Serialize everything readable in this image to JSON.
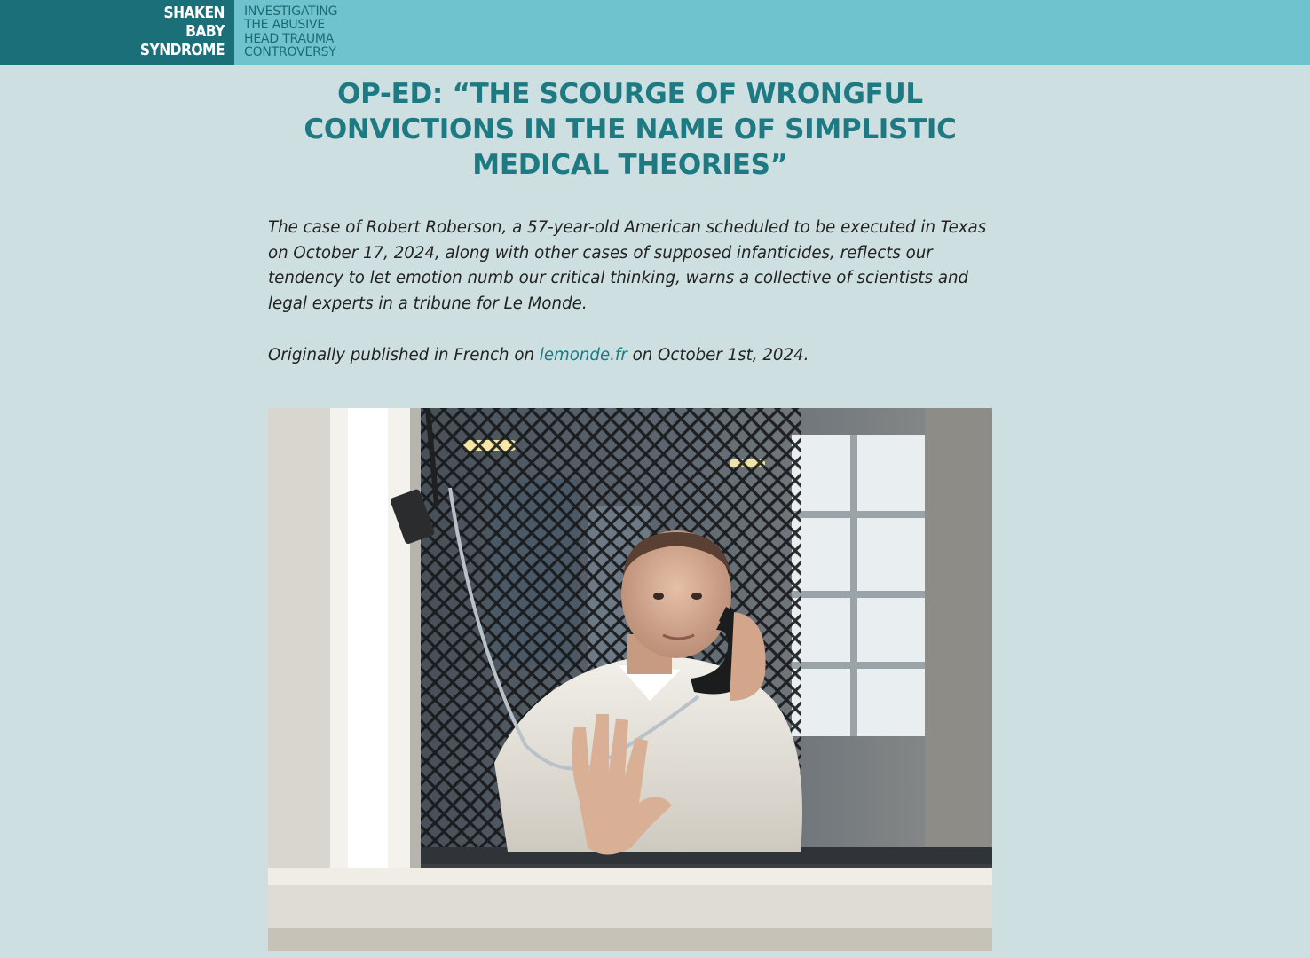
{
  "site": {
    "logo_lines": [
      "SHAKEN",
      "BABY",
      "SYNDROME"
    ],
    "tagline_lines": [
      "INVESTIGATING",
      "THE ABUSIVE",
      "HEAD TRAUMA",
      "CONTROVERSY"
    ]
  },
  "article": {
    "title_lines": [
      "OP-ED: “THE SCOURGE OF WRONGFUL",
      "CONVICTIONS IN THE NAME OF SIMPLISTIC",
      "MEDICAL THEORIES”"
    ],
    "lede": "The case of Robert Roberson, a 57-year-old American scheduled to be executed in Texas on October 17, 2024, along with other cases of supposed infanticides, reflects our tendency to let emotion numb our critical thinking, warns a collective of scientists and legal experts in a tribune for Le Monde.",
    "published_prefix": "Originally published in French on ",
    "published_link": "lemonde.fr",
    "published_suffix": " on October 1st, 2024."
  },
  "photo": {
    "subject": "man-in-prison-visiting-booth-on-phone"
  },
  "colors": {
    "header_bg": "#6fc3cf",
    "logo_bg": "#1b6f78",
    "page_bg": "#cddfe0",
    "accent": "#1d7a83"
  }
}
